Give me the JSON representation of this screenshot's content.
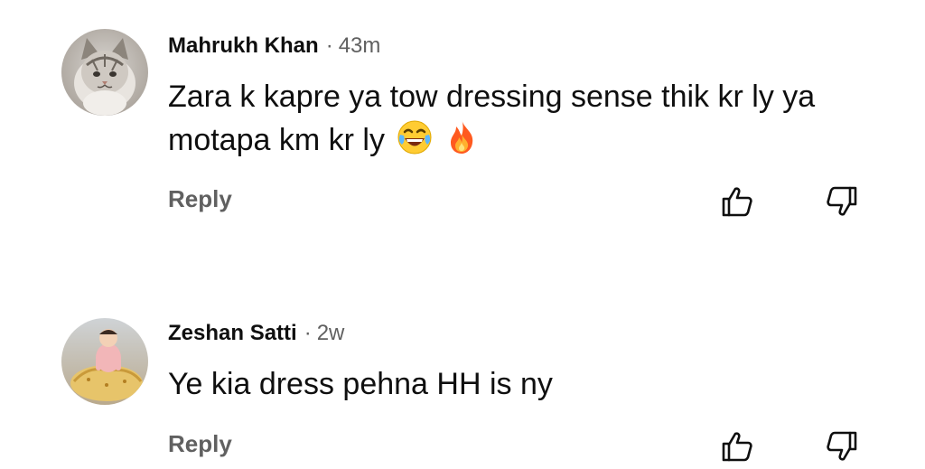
{
  "comments": [
    {
      "author": "Mahrukh Khan",
      "separator": "·",
      "time": "43m",
      "text": "Zara k kapre ya tow dressing sense thik kr ly ya motapa km kr ly",
      "emojis": [
        "laughing-tears-emoji",
        "fire-emoji"
      ],
      "reply_label": "Reply",
      "avatar": "cat-avatar"
    },
    {
      "author": "Zeshan Satti",
      "separator": "·",
      "time": "2w",
      "text": "Ye kia dress pehna HH is ny",
      "reply_label": "Reply",
      "avatar": "child-avatar"
    }
  ],
  "icons": {
    "like": "thumbs-up-icon",
    "dislike": "thumbs-down-icon"
  },
  "colors": {
    "text_primary": "#0f0f0f",
    "text_secondary": "#606060",
    "background": "#ffffff"
  }
}
